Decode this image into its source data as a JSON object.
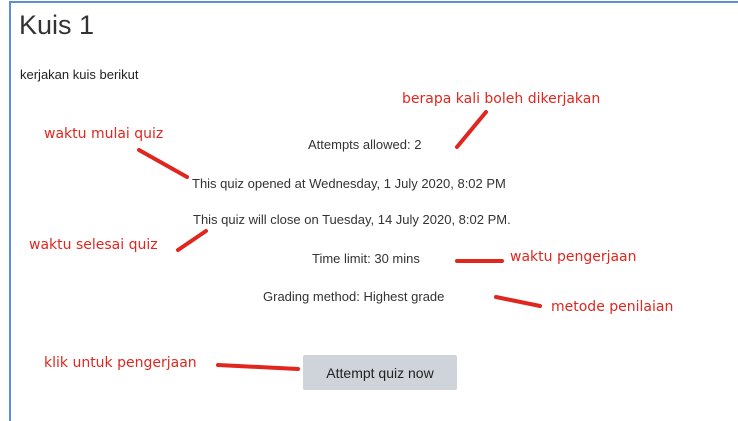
{
  "page": {
    "title": "Kuis 1",
    "intro": "kerjakan kuis berikut"
  },
  "quiz": {
    "attempts": "Attempts allowed: 2",
    "opened": "This quiz opened at Wednesday, 1 July 2020, 8:02 PM",
    "closes": "This quiz will close on Tuesday, 14 July 2020, 8:02 PM.",
    "time_limit": "Time limit: 30 mins",
    "grading": "Grading method: Highest grade",
    "attempt_button": "Attempt quiz now"
  },
  "annotations": {
    "attempts_note": "berapa kali boleh dikerjakan",
    "start_note": "waktu mulai quiz",
    "end_note": "waktu selesai quiz",
    "duration_note": "waktu pengerjaan",
    "grading_note": "metode penilaian",
    "button_note": "klik untuk pengerjaan"
  },
  "colors": {
    "annotation": "#e0261f",
    "frame_border": "#5b8fd6",
    "button_bg": "#ced4da"
  }
}
